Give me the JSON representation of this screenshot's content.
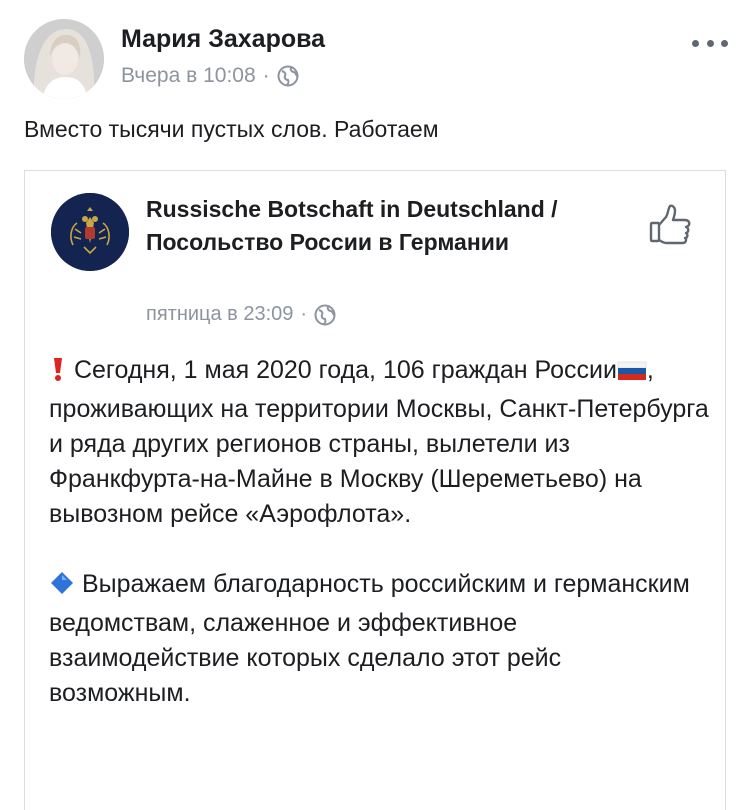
{
  "post": {
    "author_name": "Мария Захарова",
    "timestamp": "Вчера в 10:08",
    "separator": "·",
    "privacy_icon": "globe-icon",
    "more_icon": "more-options-icon",
    "text": "Вместо тысячи пустых слов. Работаем"
  },
  "shared": {
    "page_name": "Russische Botschaft in Deutschland / Посольство России в Германии",
    "timestamp": "пятница в 23:09",
    "separator": "·",
    "privacy_icon": "globe-icon",
    "like_icon": "thumbs-up-icon",
    "paragraph1_part1": "Сегодня, 1 мая 2020 года, 106 граждан России",
    "paragraph1_part2": ", проживающих на территории Москвы, Санкт-Петербурга и ряда других регионов страны, вылетели из Франкфурта-на-Майне в Москву (Шереметьево) на вывозном рейсе «Аэрофлота».",
    "paragraph2": "Выражаем благодарность российским и германским ведомствам, слаженное и эффективное взаимодействие которых сделало этот рейс возможным.",
    "emoji_exclamation": "red-exclamation-icon",
    "emoji_flag": "russian-flag-icon",
    "emoji_diamond": "blue-diamond-icon",
    "colors": {
      "page_avatar_bg": "#142451",
      "emblem_gold": "#c9a646",
      "exclamation": "#e0221f",
      "diamond": "#2f73d9"
    }
  }
}
